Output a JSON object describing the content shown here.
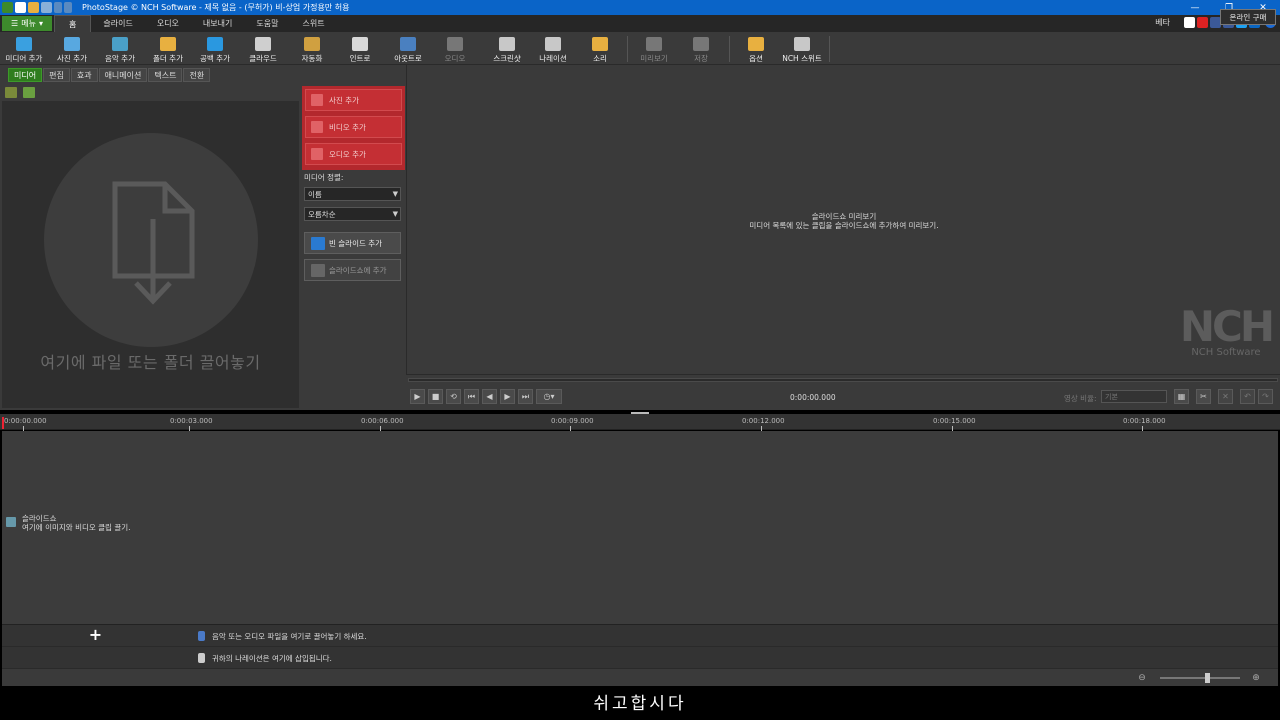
{
  "titlebar": {
    "title": "PhotoStage © NCH Software - 제목 없음 - (무허가) 비-상업 가정용만 허용",
    "minimize": "—",
    "restore": "❐",
    "close": "✕"
  },
  "menubar": {
    "menu_label": "메뉴",
    "tabs": [
      "홈",
      "슬라이드",
      "오디오",
      "내보내기",
      "도움말",
      "스위트"
    ],
    "beta": "베타",
    "help": "?"
  },
  "toolbar": {
    "buttons": [
      {
        "label": "미디어 추가",
        "icon": "media-add-icon",
        "color": "#3aa0e0"
      },
      {
        "label": "사진 추가",
        "icon": "photo-add-icon",
        "color": "#58a8e0"
      },
      {
        "label": "음악 추가",
        "icon": "music-add-icon",
        "color": "#4aa0c8"
      },
      {
        "label": "폴더 추가",
        "icon": "folder-add-icon",
        "color": "#e8b040"
      },
      {
        "label": "공백 추가",
        "icon": "blank-add-icon",
        "color": "#2a98e0"
      },
      {
        "label": "클라우드",
        "icon": "cloud-icon",
        "color": "#cfcfcf"
      },
      {
        "label": "자동화",
        "icon": "magic-wand-icon",
        "color": "#d0a040"
      },
      {
        "label": "인트로",
        "icon": "clapper-icon",
        "color": "#d8d8d8"
      },
      {
        "label": "아웃트로",
        "icon": "outro-icon",
        "color": "#4a80c0"
      },
      {
        "label": "오디오",
        "icon": "audio-sparkle-icon",
        "color": "#777777"
      },
      {
        "label": "스크린샷",
        "icon": "screenshot-icon",
        "color": "#c8c8c8"
      },
      {
        "label": "나레이션",
        "icon": "microphone-icon",
        "color": "#c8c8c8"
      },
      {
        "label": "소리",
        "icon": "sound-folder-icon",
        "color": "#e8b040"
      },
      {
        "label": "미리보기",
        "icon": "preview-icon",
        "color": "#777777"
      },
      {
        "label": "저장",
        "icon": "save-icon",
        "color": "#777777"
      },
      {
        "label": "옵션",
        "icon": "options-icon",
        "color": "#e8b040"
      },
      {
        "label": "NCH 스위트",
        "icon": "nch-suite-icon",
        "color": "#c8c8c8"
      }
    ],
    "online_buy": "온라인 구매"
  },
  "media_panel": {
    "tabs": [
      "미디어",
      "편집",
      "효과",
      "애니메이션",
      "텍스트",
      "전환"
    ],
    "drop_text": "여기에 파일 또는 폴더 끌어놓기",
    "add_photo": "사진 추가",
    "add_video": "비디오 추가",
    "add_audio": "오디오 추가",
    "sort_label": "미디어 정렬:",
    "sort_by": "이름",
    "sort_order": "오름차순",
    "blank_slide": "빈 슬라이드 추가",
    "add_to_slideshow": "슬라이드쇼에 추가"
  },
  "preview": {
    "title": "슬라이드쇼 미리보기",
    "subtitle": "미디어 목록에 있는 클립을 슬라이드쇼에 추가하여 미리보기.",
    "logo_big": "NCH",
    "logo_small": "NCH Software"
  },
  "player": {
    "time": "0:00:00.000",
    "ratio_label": "영상 비율:",
    "ratio_value": "기본"
  },
  "timeline": {
    "ticks": [
      "0:00:00.000",
      "0:00:03.000",
      "0:00:06.000",
      "0:00:09.000",
      "0:00:12.000",
      "0:00:15.000",
      "0:00:18.000"
    ],
    "slides_title": "슬라이드쇼",
    "slides_hint": "여기에 이미지와 비디오 클립 끌기.",
    "audio_hint": "음악 또는 오디오 파일을 여기로 끌어놓기 하세요.",
    "narration_hint": "귀하의 나레이션은 여기에 삽입됩니다."
  },
  "caption": "쉬고합시다",
  "colors": {
    "titlebar": "#0a64c8",
    "menu_green": "#3d8a2c",
    "add_red": "#b3282d"
  }
}
